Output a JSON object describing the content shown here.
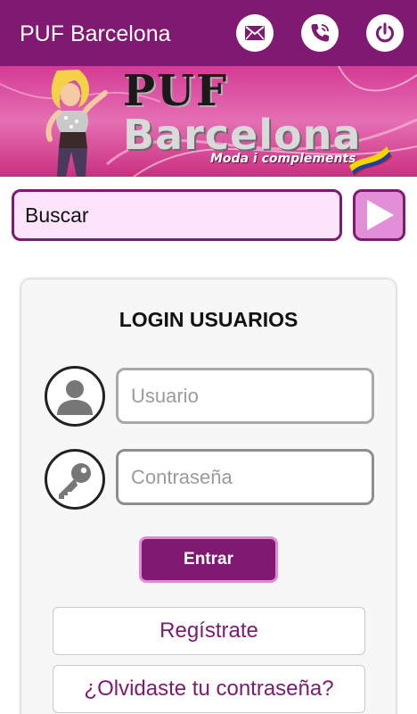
{
  "header": {
    "title": "PUF Barcelona",
    "icons": [
      "mail-icon",
      "phone-icon",
      "power-icon"
    ]
  },
  "banner": {
    "brand_top": "PUF",
    "brand_bottom": "Barcelona",
    "tagline": "Moda i complements"
  },
  "search": {
    "placeholder": "Buscar",
    "button_icon": "play-arrow-icon"
  },
  "login": {
    "title": "LOGIN USUARIOS",
    "username_placeholder": "Usuario",
    "password_placeholder": "Contraseña",
    "submit_label": "Entrar",
    "register_label": "Regístrate",
    "forgot_label": "¿Olvidaste tu contraseña?"
  },
  "colors": {
    "primary": "#7f1971",
    "search_bg": "#fde4fa",
    "accent": "#e28fd8",
    "banner": "#d43b94"
  }
}
